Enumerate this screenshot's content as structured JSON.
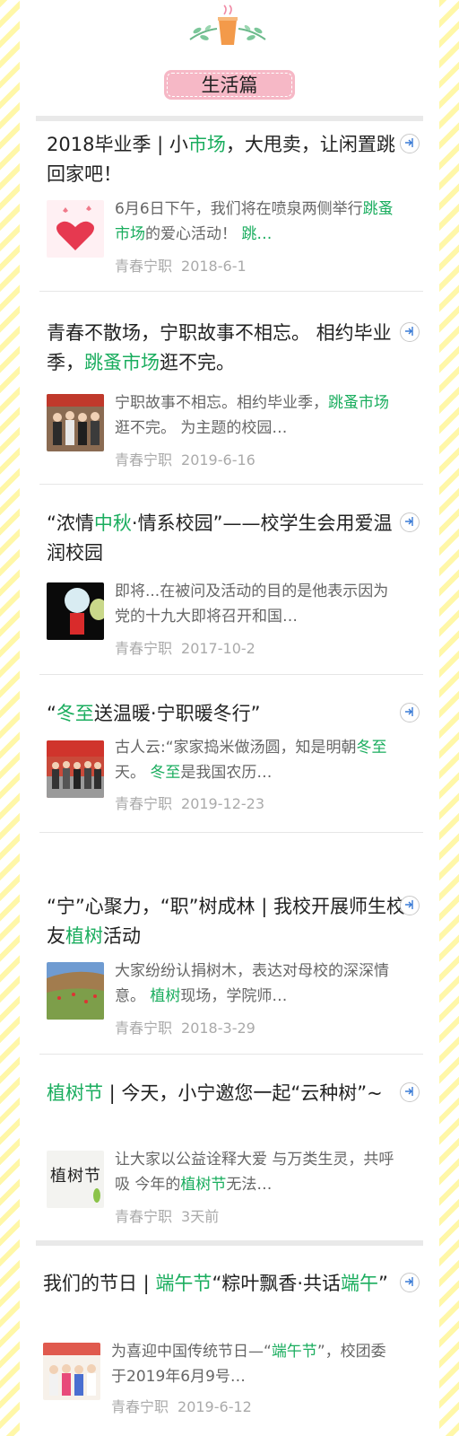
{
  "header": {
    "title": "生活篇"
  },
  "articles": [
    {
      "title_parts": [
        "2018毕业季 | 小",
        "市场",
        "，大甩卖，让闲置跳回家吧！"
      ],
      "desc_parts": [
        "6月6日下午，我们将在喷泉两侧举行",
        "跳蚤市场",
        "的爱心活动！ ",
        "跳…"
      ],
      "source": "青春宁职",
      "date": "2018-6-1"
    },
    {
      "title_parts": [
        "青春不散场，宁职故事不相忘。 相约毕业季，",
        "跳蚤市场",
        "逛不完。"
      ],
      "desc_parts": [
        "宁职故事不相忘。相约毕业季，",
        "跳蚤市场",
        "逛不完。 为主题的校园…"
      ],
      "source": "青春宁职",
      "date": "2019-6-16"
    },
    {
      "title_parts": [
        "“浓情",
        "中秋",
        "·情系校园”——校学生会用爱温润校园"
      ],
      "desc_parts": [
        "即将...在被问及活动的目的是他表示因为党的十九大即将召开和国…"
      ],
      "source": "青春宁职",
      "date": "2017-10-2"
    },
    {
      "title_parts": [
        "“",
        "冬至",
        "送温暖·宁职暖冬行”"
      ],
      "desc_parts": [
        "古人云:“家家捣米做汤圆，知是明朝",
        "冬至",
        "天。 ",
        "冬至",
        "是我国农历…"
      ],
      "source": "青春宁职",
      "date": "2019-12-23"
    },
    {
      "title_parts": [
        "“宁”心聚力，“职”树成林 | 我校开展师生校友",
        "植树",
        "活动"
      ],
      "desc_parts": [
        "大家纷纷认捐树木，表达对母校的深深情意。 ",
        "植树",
        "现场，学院师…"
      ],
      "source": "青春宁职",
      "date": "2018-3-29"
    },
    {
      "title_parts": [
        "植树节",
        " | 今天，小宁邀您一起“云种树”~"
      ],
      "desc_parts": [
        "让大家以公益诠释大爱 与万类生灵，共呼吸 今年的",
        "植树节",
        "无法…"
      ],
      "source": "青春宁职",
      "date": "3天前",
      "thumb_text": "植树节"
    },
    {
      "title_parts": [
        "我们的节日 | ",
        "端午节",
        "“粽叶飘香·共话",
        "端午",
        "”"
      ],
      "desc_parts": [
        "为喜迎中国传统节日—“",
        "端午节",
        "”，校团委于2019年6月9号…"
      ],
      "source": "青春宁职",
      "date": "2019-6-12"
    }
  ],
  "colors": {
    "highlight": "#1aad5e",
    "pill": "#f6b8c6",
    "stripe": "#fff7a8"
  }
}
